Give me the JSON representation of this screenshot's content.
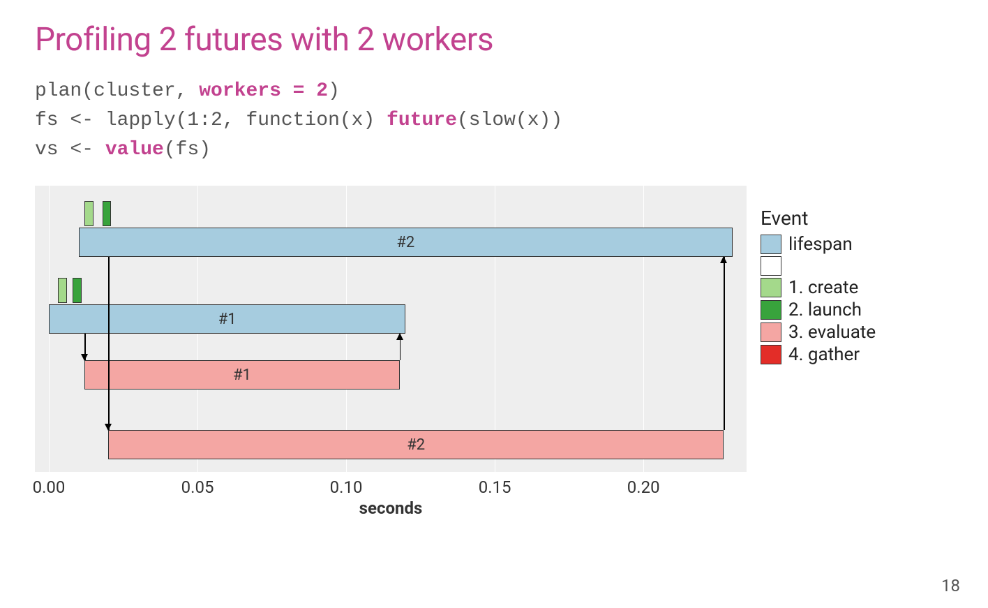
{
  "title": "Profiling 2 futures with 2 workers",
  "code": {
    "l1a": "plan(cluster, ",
    "l1b": "workers = 2",
    "l1c": ")",
    "l2a": "fs <- lapply(1:2, function(x) ",
    "l2b": "future",
    "l2c": "(slow(x))",
    "l3a": "vs <- ",
    "l3b": "value",
    "l3c": "(fs)"
  },
  "chart_data": {
    "type": "gantt",
    "xlabel": "seconds",
    "xlim": [
      0,
      0.23
    ],
    "x_ticks": [
      0.0,
      0.05,
      0.1,
      0.15,
      0.2
    ],
    "x_tick_labels": [
      "0.00",
      "0.05",
      "0.10",
      "0.15",
      "0.20"
    ],
    "legend_title": "Event",
    "legend": [
      {
        "label": "lifespan",
        "color": "#a6ccdf"
      },
      {
        "label": "",
        "color": "#ffffff"
      },
      {
        "label": "1. create",
        "color": "#a4d98b"
      },
      {
        "label": "2. launch",
        "color": "#38a33c"
      },
      {
        "label": "3. evaluate",
        "color": "#f4a6a3"
      },
      {
        "label": "4. gather",
        "color": "#e32d28"
      }
    ],
    "bars": [
      {
        "id": "future2-lifespan",
        "label": "#2",
        "row": 0,
        "start": 0.01,
        "end": 0.23,
        "color": "#a6ccdf"
      },
      {
        "id": "future2-create",
        "label": "",
        "row": 0,
        "start": 0.012,
        "end": 0.015,
        "color": "#a4d98b",
        "tick": true
      },
      {
        "id": "future2-launch",
        "label": "",
        "row": 0,
        "start": 0.018,
        "end": 0.021,
        "color": "#38a33c",
        "tick": true
      },
      {
        "id": "future1-lifespan",
        "label": "#1",
        "row": 1,
        "start": 0.0,
        "end": 0.12,
        "color": "#a6ccdf"
      },
      {
        "id": "future1-create",
        "label": "",
        "row": 1,
        "start": 0.003,
        "end": 0.006,
        "color": "#a4d98b",
        "tick": true
      },
      {
        "id": "future1-launch",
        "label": "",
        "row": 1,
        "start": 0.008,
        "end": 0.011,
        "color": "#38a33c",
        "tick": true
      },
      {
        "id": "future1-evaluate",
        "label": "#1",
        "row": 2,
        "start": 0.012,
        "end": 0.118,
        "color": "#f4a6a3"
      },
      {
        "id": "future2-evaluate",
        "label": "#2",
        "row": 3,
        "start": 0.02,
        "end": 0.227,
        "color": "#f4a6a3"
      }
    ],
    "arrows": [
      {
        "x": 0.012,
        "from_row": 1,
        "to_row": 2,
        "dir": "down"
      },
      {
        "x": 0.118,
        "from_row": 2,
        "to_row": 1,
        "dir": "up"
      },
      {
        "x": 0.02,
        "from_row": 0,
        "to_row": 3,
        "dir": "down"
      },
      {
        "x": 0.227,
        "from_row": 3,
        "to_row": 0,
        "dir": "up"
      }
    ]
  },
  "page_number": "18"
}
